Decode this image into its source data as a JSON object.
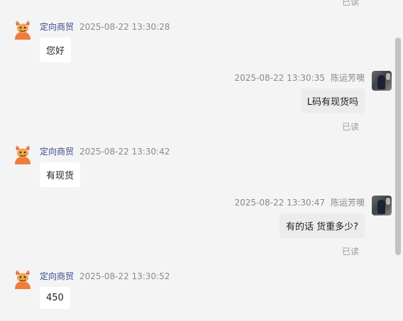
{
  "status_top": "已读",
  "messages": [
    {
      "direction": "in",
      "sender": "定向商贸",
      "time": "2025-08-22 13:30:28",
      "text": "您好",
      "avatar_icon": "cartoon-mascot-icon"
    },
    {
      "direction": "out",
      "sender": "陈运芳噢",
      "time": "2025-08-22 13:30:35",
      "text": "L码有现货吗",
      "status": "已读",
      "avatar_icon": "photo-avatar"
    },
    {
      "direction": "in",
      "sender": "定向商贸",
      "time": "2025-08-22 13:30:42",
      "text": "有现货",
      "avatar_icon": "cartoon-mascot-icon"
    },
    {
      "direction": "out",
      "sender": "陈运芳噢",
      "time": "2025-08-22 13:30:47",
      "text": "有的话 货重多少?",
      "status": "已读",
      "avatar_icon": "photo-avatar"
    },
    {
      "direction": "in",
      "sender": "定向商贸",
      "time": "2025-08-22 13:30:52",
      "text": "450",
      "avatar_icon": "cartoon-mascot-icon"
    }
  ],
  "colors": {
    "background": "#f4f4f4",
    "incoming_bubble": "#ffffff",
    "outgoing_bubble": "#ececec",
    "sender_name": "#3b4a8c",
    "timestamp": "#8a8a8a",
    "scrollbar": "#c2c2c2",
    "mascot": "#f07c3c"
  }
}
